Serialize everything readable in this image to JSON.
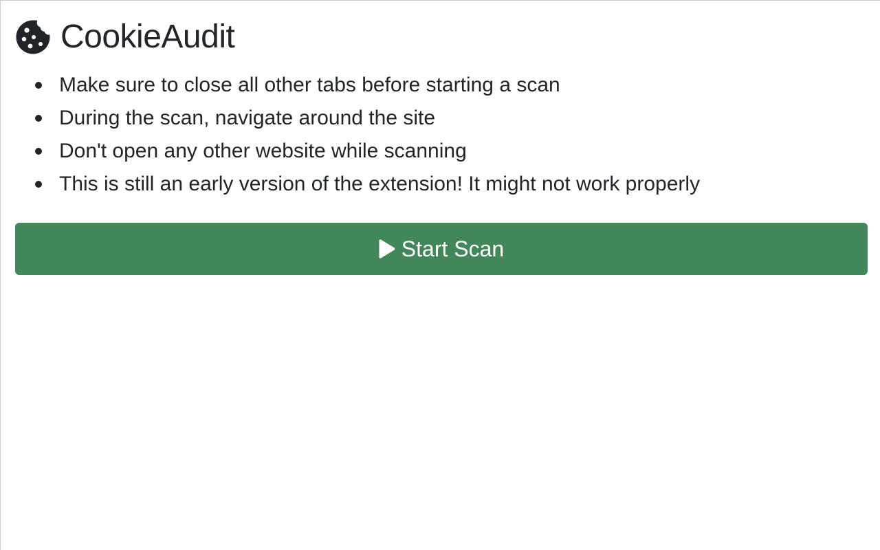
{
  "app": {
    "title": "CookieAudit",
    "logo_icon": "cookie-icon"
  },
  "instructions": {
    "items": [
      "Make sure to close all other tabs before starting a scan",
      "During the scan, navigate around the site",
      "Don't open any other website while scanning",
      "This is still an early version of the extension! It might not work properly"
    ]
  },
  "actions": {
    "start_scan_label": "Start Scan",
    "start_scan_icon": "play-icon"
  },
  "colors": {
    "text": "#212529",
    "button_bg": "#428759",
    "button_text": "#ffffff",
    "background": "#ffffff"
  }
}
